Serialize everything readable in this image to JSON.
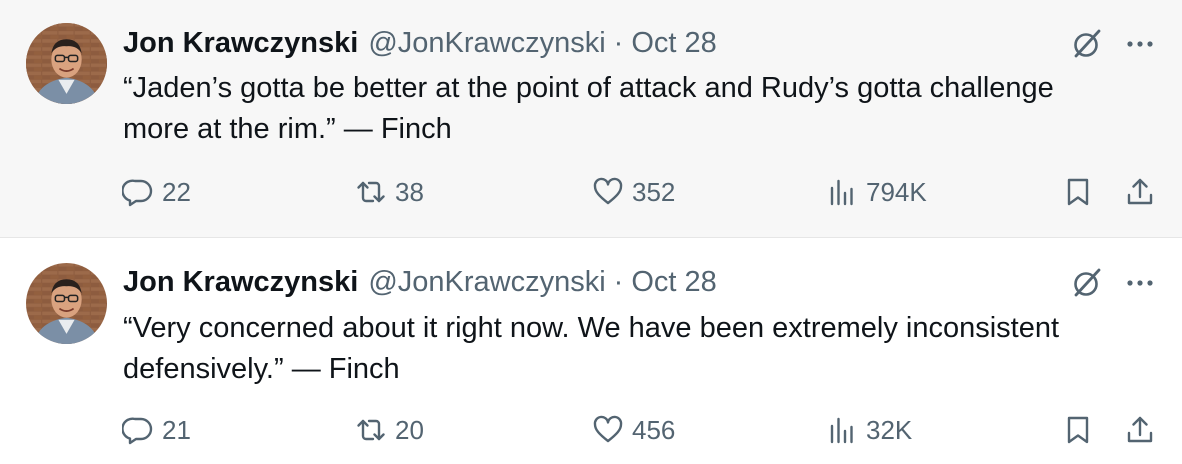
{
  "tweets": [
    {
      "author_name": "Jon Krawczynski",
      "handle": "@JonKrawczynski",
      "separator": "·",
      "date": "Oct 28",
      "text": "“Jaden’s gotta be better at the point of attack and Rudy’s gotta challenge\nmore at the rim.” — Finch",
      "replies": "22",
      "retweets": "38",
      "likes": "352",
      "views": "794K"
    },
    {
      "author_name": "Jon Krawczynski",
      "handle": "@JonKrawczynski",
      "separator": "·",
      "date": "Oct 28",
      "text": "“Very concerned about it right now. We have been extremely inconsistent\ndefensively.” — Finch",
      "replies": "21",
      "retweets": "20",
      "likes": "456",
      "views": "32K"
    }
  ],
  "icons": {
    "reply": "speech-bubble-icon",
    "retweet": "retweet-arrows-icon",
    "like": "heart-icon",
    "views": "bar-chart-icon",
    "bookmark": "bookmark-icon",
    "share": "share-upload-icon",
    "grok": "grok-slash-icon",
    "more": "three-dots-icon"
  },
  "colors": {
    "text_primary": "#0f1419",
    "text_secondary": "#536471",
    "highlight_background": "#f7f7f7"
  }
}
